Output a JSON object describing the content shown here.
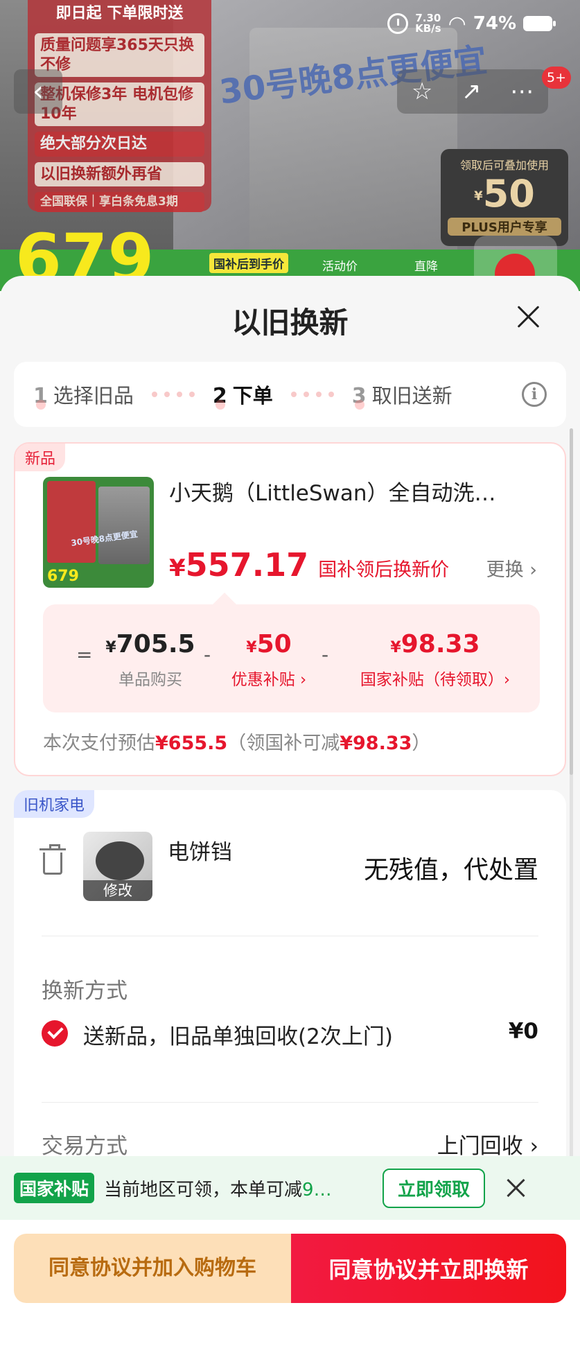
{
  "status": {
    "net_speed": "7.30",
    "net_unit": "KB/s",
    "battery": "74%"
  },
  "background": {
    "promo_top": "即日起 下单限时送",
    "promo_lines": [
      "质量问题享365天只换不修",
      "整机保修3年 电机包修10年",
      "绝大部分次日达",
      "以旧换新额外再省",
      "全国联保｜享白条免息3期"
    ],
    "banner": "30号晚8点更便宜",
    "coupon_top": "领取后可叠加使用",
    "coupon_yen": "¥",
    "coupon_value": "50",
    "coupon_tag": "PLUS用户专享",
    "price": "679",
    "price_tag": "国补后到手价",
    "labels": [
      "活动价",
      "直降"
    ],
    "nav_badge": "5+"
  },
  "sheet": {
    "title": "以旧换新",
    "steps": [
      {
        "num": "1",
        "label": "选择旧品"
      },
      {
        "num": "2",
        "label": "下单"
      },
      {
        "num": "3",
        "label": "取旧送新"
      }
    ],
    "new_item": {
      "tag": "新品",
      "title": "小天鹅（LittleSwan）全自动洗…",
      "thumb_price": "679",
      "thumb_banner": "30号晚8点更便宜",
      "price_yen": "¥",
      "price": "557.17",
      "price_note": "国补领后换新价",
      "change": "更换 ›",
      "breakdown": {
        "eq": "=",
        "minus1": "-",
        "minus2": "-",
        "buy_yen": "¥",
        "buy_value": "705.5",
        "buy_label": "单品购买",
        "coupon_yen": "¥",
        "coupon_value": "50",
        "coupon_label": "优惠补贴 ›",
        "gov_yen": "¥",
        "gov_value": "98.33",
        "gov_label": "国家补贴（待领取）›"
      },
      "pay_prefix": "本次支付预估",
      "pay_amount": "¥655.5",
      "pay_mid": "（领国补可减",
      "pay_reduce": "¥98.33",
      "pay_suffix": "）"
    },
    "old_item": {
      "tag": "旧机家电",
      "edit": "修改",
      "name": "电饼铛",
      "value_text": "无残值，代处置",
      "method_label": "换新方式",
      "method_text": "送新品，旧品单独回收(2次上门)",
      "method_price": "¥0",
      "trade_label": "交易方式",
      "trade_value": "上门回收 ›"
    }
  },
  "subsidy": {
    "badge": "国家补贴",
    "text": "当前地区可领，本单可减",
    "amount": "9…",
    "button": "立即领取"
  },
  "actions": {
    "add_cart": "同意协议并加入购物车",
    "buy_now": "同意协议并立即换新"
  }
}
